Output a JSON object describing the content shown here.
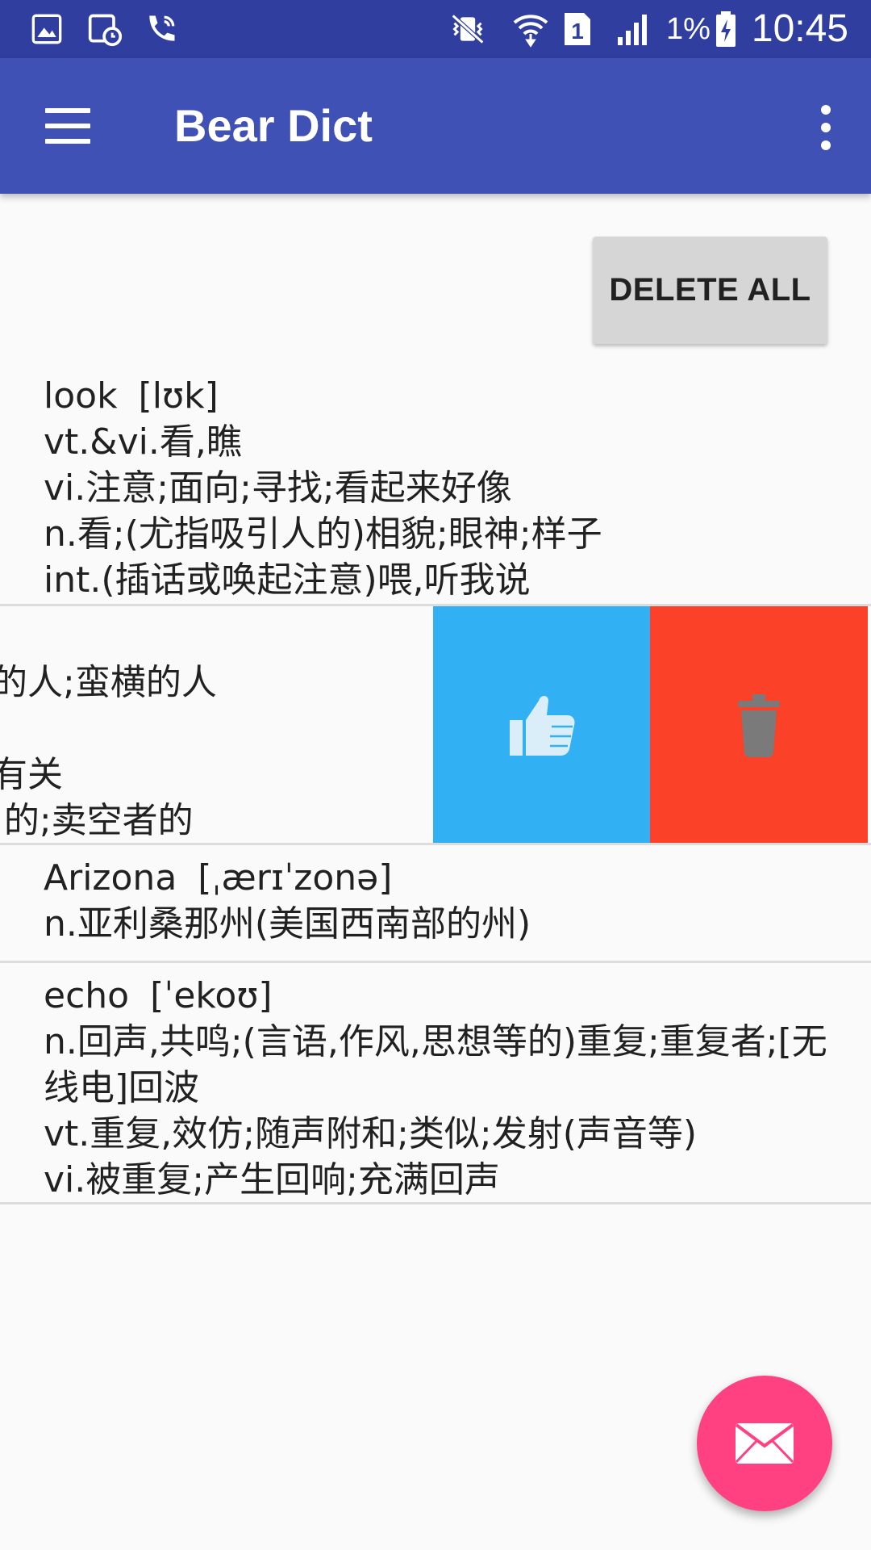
{
  "status_bar": {
    "battery_percent": "1%",
    "time": "10:45",
    "sim_slot": "1",
    "icons": [
      "gallery-icon",
      "calendar-clock-icon",
      "wifi-call-icon",
      "vibrate-mute-icon",
      "wifi-icon",
      "sim-icon",
      "signal-icon",
      "battery-charging-icon"
    ]
  },
  "app_bar": {
    "title": "Bear Dict",
    "menu_icon": "hamburger-menu-icon",
    "overflow_icon": "more-vert-icon",
    "color": "#3f51b5"
  },
  "toolbar": {
    "delete_all_label": "DELETE ALL"
  },
  "words": [
    {
      "word": "look",
      "phonetic": "[lʊk]",
      "definitions": [
        "vt.&vi.看,瞧",
        "vi.注意;面向;寻找;看起来好像",
        "n.看;(尤指吸引人的)相貌;眼神;样子",
        "int.(插话或唤起注意)喂,听我说"
      ]
    },
    {
      "swiped": true,
      "visible_fragments": [
        "的人;蛮横的人",
        "有关",
        ":的;卖空者的"
      ],
      "actions": {
        "like_icon": "thumbs-up-icon",
        "like_color": "#31b0f3",
        "delete_icon": "trash-icon",
        "delete_color": "#fb4128"
      }
    },
    {
      "word": "Arizona",
      "phonetic": "[ˌærɪˈzonə]",
      "definitions": [
        "n.亚利桑那州(美国西南部的州)"
      ]
    },
    {
      "word": "echo",
      "phonetic": "[ˈekoʊ]",
      "definitions": [
        "n.回声,共鸣;(言语,作风,思想等的)重复;重复者;[无线电]回波",
        "vt.重复,效仿;随声附和;类似;发射(声音等)",
        "vi.被重复;产生回响;充满回声"
      ]
    }
  ],
  "fab": {
    "icon": "mail-icon",
    "color": "#ff4081"
  }
}
